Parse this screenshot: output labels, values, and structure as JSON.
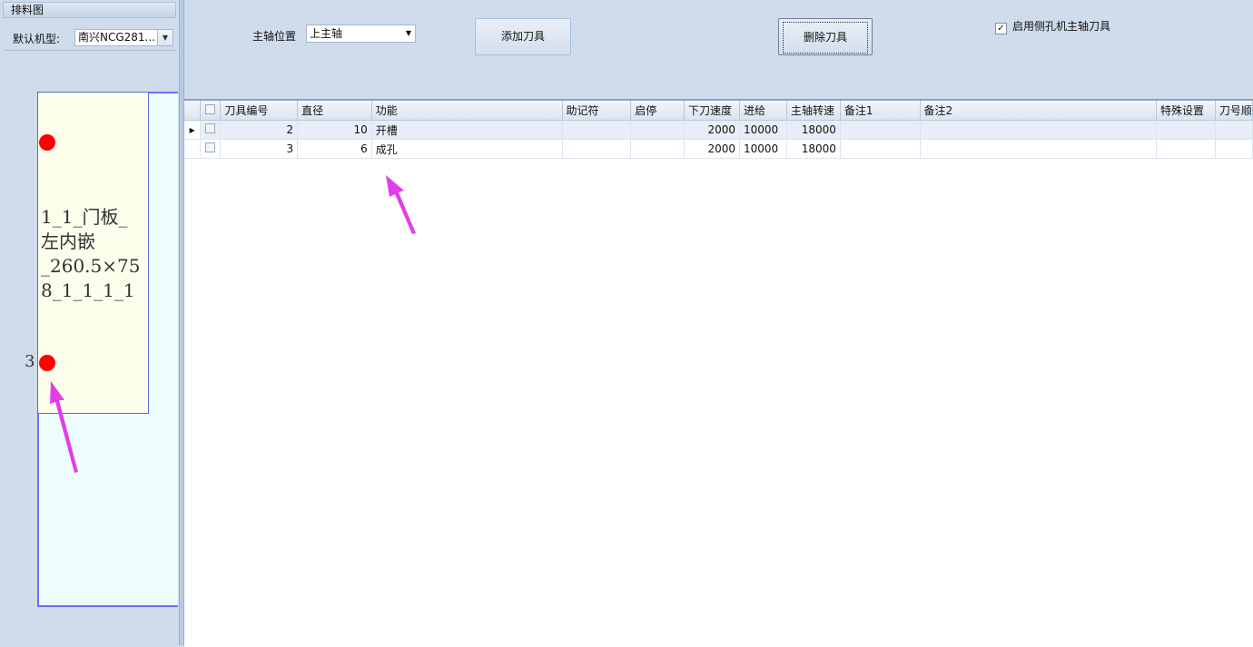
{
  "left_panel": {
    "header": "排料图",
    "machine_label": "默认机型:",
    "machine_value": "南兴NCG281...",
    "part_label": "1_1_门板_\n左内嵌\n_260.5×75\n8_1_1_1_1",
    "hole_number": "3"
  },
  "toolbar": {
    "spindle_label": "主轴位置",
    "spindle_value": "上主轴",
    "add_tool": "添加刀具",
    "delete_tool": "删除刀具",
    "side_spindle_check": "启用侧孔机主轴刀具",
    "side_spindle_checked": true
  },
  "grid": {
    "columns": [
      "刀具编号",
      "直径",
      "功能",
      "助记符",
      "启停",
      "下刀速度",
      "进给",
      "主轴转速",
      "备注1",
      "备注2",
      "特殊设置",
      "刀号顺"
    ],
    "rows": [
      {
        "tool_no": "2",
        "diameter": "10",
        "function": "开槽",
        "mnemonic": "",
        "start_stop": "",
        "plunge": "2000",
        "feed": "10000",
        "spindle_speed": "18000",
        "note1": "",
        "note2": "",
        "special": ""
      },
      {
        "tool_no": "3",
        "diameter": "6",
        "function": "成孔",
        "mnemonic": "",
        "start_stop": "",
        "plunge": "2000",
        "feed": "10000",
        "spindle_speed": "18000",
        "note1": "",
        "note2": "",
        "special": ""
      }
    ]
  },
  "colors": {
    "accent_arrow": "#e23ee8",
    "hole_dot": "#ff0000"
  }
}
